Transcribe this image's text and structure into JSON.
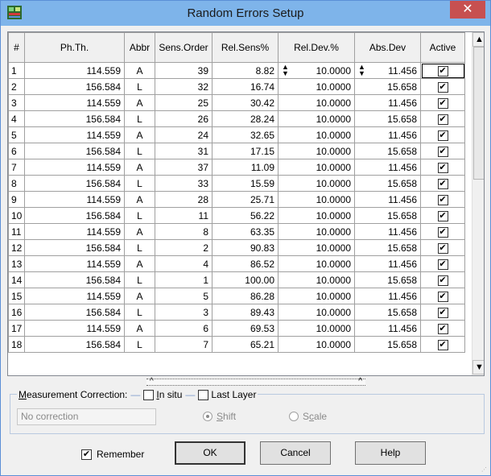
{
  "window": {
    "title": "Random Errors Setup",
    "close_glyph": "✕",
    "icon": "app-icon-green-red"
  },
  "table": {
    "headers": [
      "#",
      "Ph.Th.",
      "Abbr",
      "Sens.Order",
      "Rel.Sens%",
      "Rel.Dev.%",
      "Abs.Dev",
      "Active"
    ],
    "rows": [
      [
        "1",
        "114.559",
        "A",
        "39",
        "8.82",
        "10.0000",
        "11.456"
      ],
      [
        "2",
        "156.584",
        "L",
        "32",
        "16.74",
        "10.0000",
        "15.658"
      ],
      [
        "3",
        "114.559",
        "A",
        "25",
        "30.42",
        "10.0000",
        "11.456"
      ],
      [
        "4",
        "156.584",
        "L",
        "26",
        "28.24",
        "10.0000",
        "15.658"
      ],
      [
        "5",
        "114.559",
        "A",
        "24",
        "32.65",
        "10.0000",
        "11.456"
      ],
      [
        "6",
        "156.584",
        "L",
        "31",
        "17.15",
        "10.0000",
        "15.658"
      ],
      [
        "7",
        "114.559",
        "A",
        "37",
        "11.09",
        "10.0000",
        "11.456"
      ],
      [
        "8",
        "156.584",
        "L",
        "33",
        "15.59",
        "10.0000",
        "15.658"
      ],
      [
        "9",
        "114.559",
        "A",
        "28",
        "25.71",
        "10.0000",
        "11.456"
      ],
      [
        "10",
        "156.584",
        "L",
        "11",
        "56.22",
        "10.0000",
        "15.658"
      ],
      [
        "11",
        "114.559",
        "A",
        "8",
        "63.35",
        "10.0000",
        "11.456"
      ],
      [
        "12",
        "156.584",
        "L",
        "2",
        "90.83",
        "10.0000",
        "15.658"
      ],
      [
        "13",
        "114.559",
        "A",
        "4",
        "86.52",
        "10.0000",
        "11.456"
      ],
      [
        "14",
        "156.584",
        "L",
        "1",
        "100.00",
        "10.0000",
        "15.658"
      ],
      [
        "15",
        "114.559",
        "A",
        "5",
        "86.28",
        "10.0000",
        "11.456"
      ],
      [
        "16",
        "156.584",
        "L",
        "3",
        "89.43",
        "10.0000",
        "15.658"
      ],
      [
        "17",
        "114.559",
        "A",
        "6",
        "69.53",
        "10.0000",
        "11.456"
      ]
    ],
    "partial_row": [
      "18",
      "156.584",
      "L",
      "7",
      "65.21",
      "10.0000",
      "15.658"
    ],
    "active_checked": true,
    "check_glyph": "✔"
  },
  "scroll": {
    "up": "▲",
    "down": "▼",
    "left": "^",
    "right": "^"
  },
  "measurement": {
    "label_prefix": "M",
    "label_rest": "easurement Correction:",
    "in_situ_prefix": "I",
    "in_situ_rest": "n situ",
    "last_layer": "Last Layer",
    "correction_value": "No correction",
    "shift_label_s": "S",
    "shift_label_rest": "hift",
    "scale_label_pre": "S",
    "scale_label_c": "c",
    "scale_label_rest": "ale",
    "shift_selected": true
  },
  "footer": {
    "remember_label": "Remember",
    "remember_checked": true,
    "ok_label": "OK",
    "cancel_label": "Cancel",
    "help_label": "Help"
  },
  "colors": {
    "titlebar": "#7eb4ea",
    "close": "#c75050",
    "dialog_bg": "#f0f0f0"
  }
}
